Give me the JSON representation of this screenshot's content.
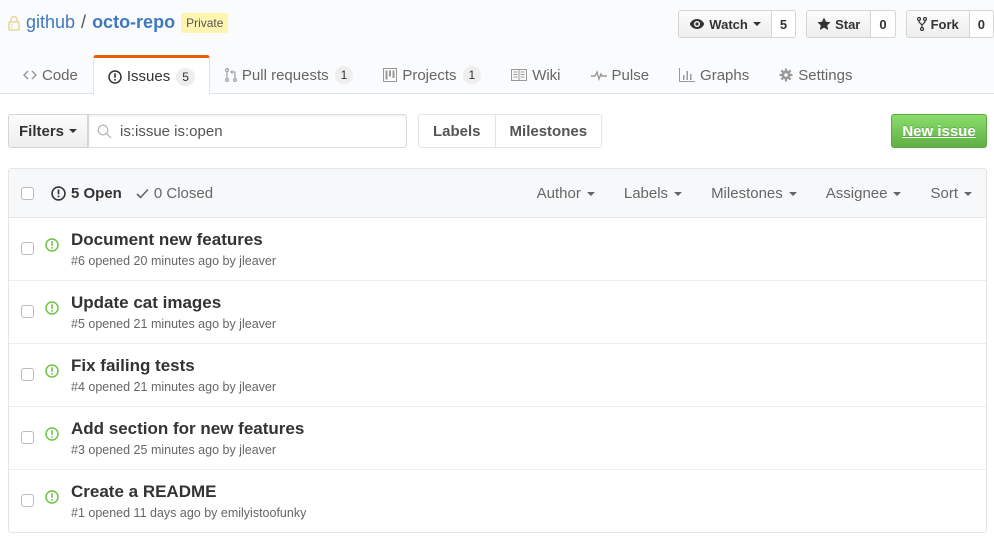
{
  "repo": {
    "owner": "github",
    "separator": "/",
    "name": "octo-repo",
    "visibility": "Private"
  },
  "actions": {
    "watch_label": "Watch",
    "watch_count": "5",
    "star_label": "Star",
    "star_count": "0",
    "fork_label": "Fork",
    "fork_count": "0"
  },
  "nav": {
    "tabs": [
      {
        "label": "Code",
        "icon": "code-icon"
      },
      {
        "label": "Issues",
        "icon": "issue-opened-icon",
        "count": "5",
        "selected": true
      },
      {
        "label": "Pull requests",
        "icon": "git-pull-request-icon",
        "count": "1"
      },
      {
        "label": "Projects",
        "icon": "project-icon",
        "count": "1"
      },
      {
        "label": "Wiki",
        "icon": "book-icon"
      },
      {
        "label": "Pulse",
        "icon": "pulse-icon"
      },
      {
        "label": "Graphs",
        "icon": "graph-icon"
      },
      {
        "label": "Settings",
        "icon": "gear-icon"
      }
    ]
  },
  "subnav": {
    "filters_label": "Filters",
    "search_value": "is:issue is:open",
    "labels_label": "Labels",
    "milestones_label": "Milestones",
    "new_issue_label": "New issue"
  },
  "issues_header": {
    "open_label": "5 Open",
    "closed_label": "0 Closed",
    "filters": [
      "Author",
      "Labels",
      "Milestones",
      "Assignee",
      "Sort"
    ]
  },
  "issues": [
    {
      "title": "Document new features",
      "meta": "#6 opened 20 minutes ago by jleaver"
    },
    {
      "title": "Update cat images",
      "meta": "#5 opened 21 minutes ago by jleaver"
    },
    {
      "title": "Fix failing tests",
      "meta": "#4 opened 21 minutes ago by jleaver"
    },
    {
      "title": "Add section for new features",
      "meta": "#3 opened 25 minutes ago by jleaver"
    },
    {
      "title": "Create a README",
      "meta": "#1 opened 11 days ago by emilyistoofunky"
    }
  ],
  "colors": {
    "link": "#4078c0",
    "selected_tab_accent": "#e36209",
    "open_issue": "#6cc644",
    "new_issue_button": "#60b044",
    "private_badge": "#fff5b1"
  }
}
